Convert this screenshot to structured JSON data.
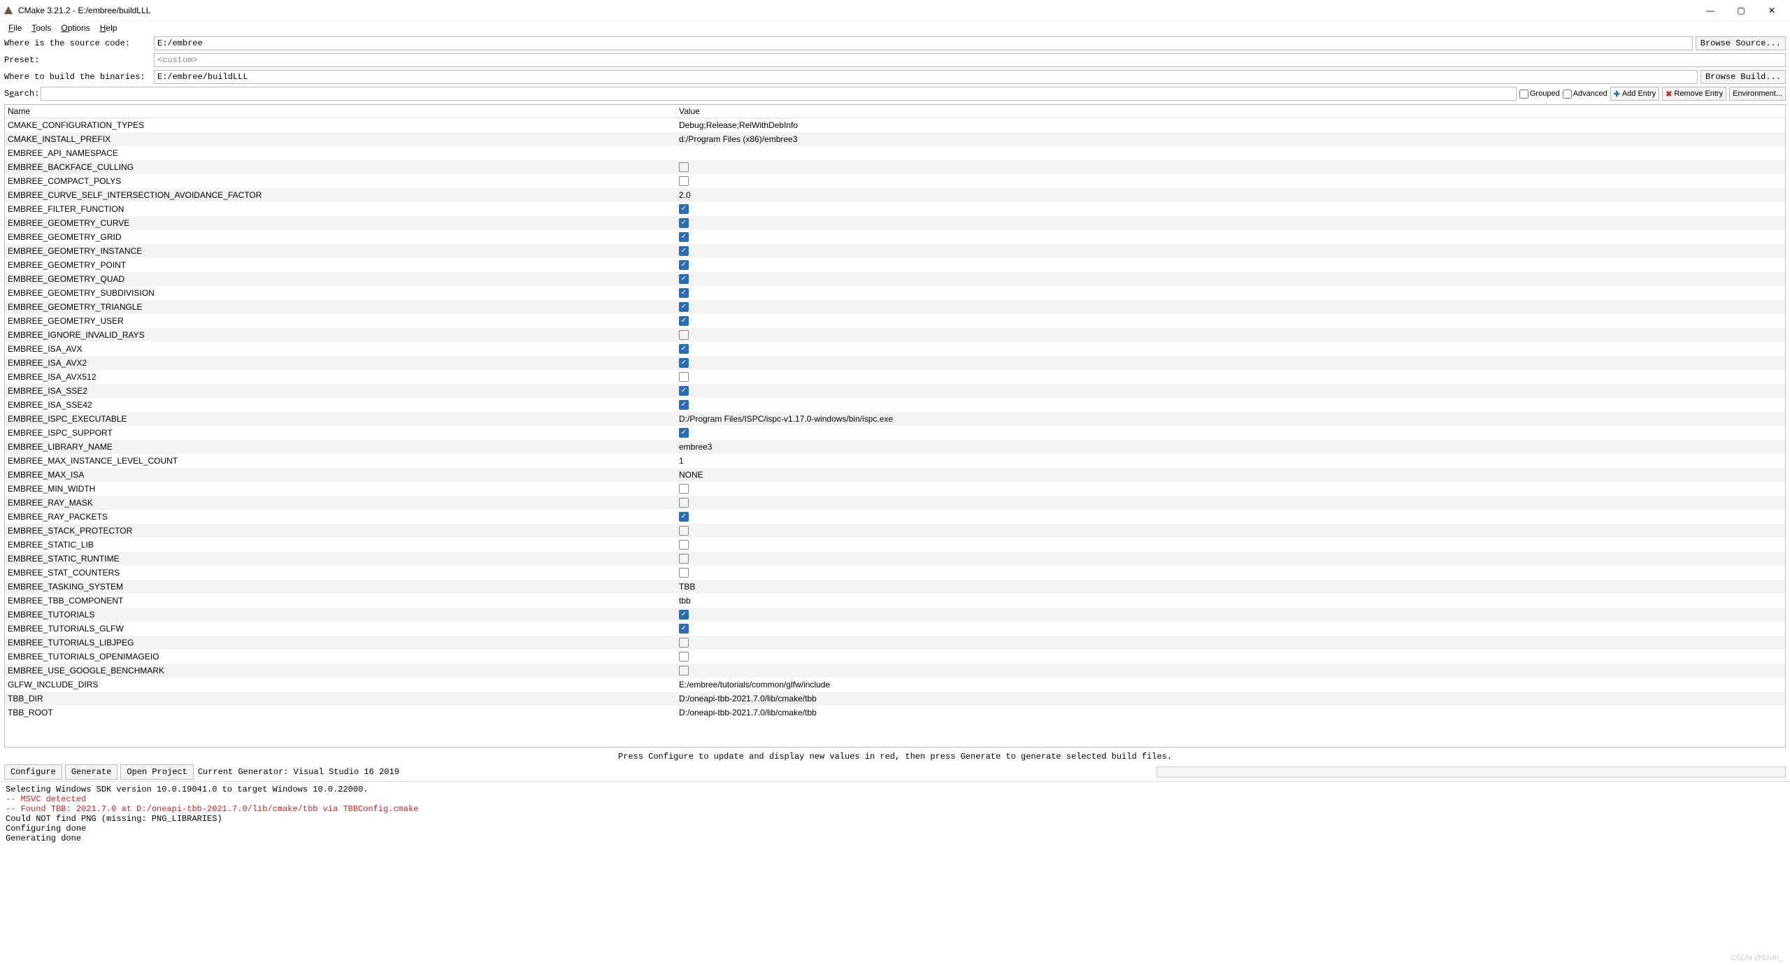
{
  "window": {
    "title": "CMake 3.21.2 - E:/embree/buildLLL",
    "minimize": "—",
    "maximize": "▢",
    "close": "✕"
  },
  "menu": {
    "file": "File",
    "tools": "Tools",
    "options": "Options",
    "help": "Help"
  },
  "paths": {
    "source_label": "Where is the source code:",
    "source_value": "E:/embree",
    "browse_source": "Browse Source...",
    "preset_label": "Preset:",
    "preset_value": "<custom>",
    "build_label": "Where to build the binaries:",
    "build_value": "E:/embree/buildLLL",
    "browse_build": "Browse Build..."
  },
  "search": {
    "label": "Search:",
    "value": "",
    "grouped": "Grouped",
    "advanced": "Advanced",
    "add_entry": "Add Entry",
    "remove_entry": "Remove Entry",
    "environment": "Environment..."
  },
  "table": {
    "header_name": "Name",
    "header_value": "Value",
    "rows": [
      {
        "name": "CMAKE_CONFIGURATION_TYPES",
        "type": "text",
        "value": "Debug;Release;RelWithDebInfo"
      },
      {
        "name": "CMAKE_INSTALL_PREFIX",
        "type": "text",
        "value": "d:/Program Files (x86)/embree3"
      },
      {
        "name": "EMBREE_API_NAMESPACE",
        "type": "text",
        "value": ""
      },
      {
        "name": "EMBREE_BACKFACE_CULLING",
        "type": "check",
        "value": false
      },
      {
        "name": "EMBREE_COMPACT_POLYS",
        "type": "check",
        "value": false
      },
      {
        "name": "EMBREE_CURVE_SELF_INTERSECTION_AVOIDANCE_FACTOR",
        "type": "text",
        "value": "2.0"
      },
      {
        "name": "EMBREE_FILTER_FUNCTION",
        "type": "check",
        "value": true
      },
      {
        "name": "EMBREE_GEOMETRY_CURVE",
        "type": "check",
        "value": true
      },
      {
        "name": "EMBREE_GEOMETRY_GRID",
        "type": "check",
        "value": true
      },
      {
        "name": "EMBREE_GEOMETRY_INSTANCE",
        "type": "check",
        "value": true
      },
      {
        "name": "EMBREE_GEOMETRY_POINT",
        "type": "check",
        "value": true
      },
      {
        "name": "EMBREE_GEOMETRY_QUAD",
        "type": "check",
        "value": true
      },
      {
        "name": "EMBREE_GEOMETRY_SUBDIVISION",
        "type": "check",
        "value": true
      },
      {
        "name": "EMBREE_GEOMETRY_TRIANGLE",
        "type": "check",
        "value": true
      },
      {
        "name": "EMBREE_GEOMETRY_USER",
        "type": "check",
        "value": true
      },
      {
        "name": "EMBREE_IGNORE_INVALID_RAYS",
        "type": "check",
        "value": false
      },
      {
        "name": "EMBREE_ISA_AVX",
        "type": "check",
        "value": true
      },
      {
        "name": "EMBREE_ISA_AVX2",
        "type": "check",
        "value": true
      },
      {
        "name": "EMBREE_ISA_AVX512",
        "type": "check",
        "value": false
      },
      {
        "name": "EMBREE_ISA_SSE2",
        "type": "check",
        "value": true
      },
      {
        "name": "EMBREE_ISA_SSE42",
        "type": "check",
        "value": true
      },
      {
        "name": "EMBREE_ISPC_EXECUTABLE",
        "type": "text",
        "value": "D:/Program Files/ISPC/ispc-v1.17.0-windows/bin/ispc.exe"
      },
      {
        "name": "EMBREE_ISPC_SUPPORT",
        "type": "check",
        "value": true
      },
      {
        "name": "EMBREE_LIBRARY_NAME",
        "type": "text",
        "value": "embree3"
      },
      {
        "name": "EMBREE_MAX_INSTANCE_LEVEL_COUNT",
        "type": "text",
        "value": "1"
      },
      {
        "name": "EMBREE_MAX_ISA",
        "type": "text",
        "value": "NONE"
      },
      {
        "name": "EMBREE_MIN_WIDTH",
        "type": "check",
        "value": false
      },
      {
        "name": "EMBREE_RAY_MASK",
        "type": "check",
        "value": false
      },
      {
        "name": "EMBREE_RAY_PACKETS",
        "type": "check",
        "value": true
      },
      {
        "name": "EMBREE_STACK_PROTECTOR",
        "type": "check",
        "value": false
      },
      {
        "name": "EMBREE_STATIC_LIB",
        "type": "check",
        "value": false
      },
      {
        "name": "EMBREE_STATIC_RUNTIME",
        "type": "check",
        "value": false
      },
      {
        "name": "EMBREE_STAT_COUNTERS",
        "type": "check",
        "value": false
      },
      {
        "name": "EMBREE_TASKING_SYSTEM",
        "type": "text",
        "value": "TBB"
      },
      {
        "name": "EMBREE_TBB_COMPONENT",
        "type": "text",
        "value": "tbb"
      },
      {
        "name": "EMBREE_TUTORIALS",
        "type": "check",
        "value": true
      },
      {
        "name": "EMBREE_TUTORIALS_GLFW",
        "type": "check",
        "value": true
      },
      {
        "name": "EMBREE_TUTORIALS_LIBJPEG",
        "type": "check",
        "value": false
      },
      {
        "name": "EMBREE_TUTORIALS_OPENIMAGEIO",
        "type": "check",
        "value": false
      },
      {
        "name": "EMBREE_USE_GOOGLE_BENCHMARK",
        "type": "check",
        "value": false
      },
      {
        "name": "GLFW_INCLUDE_DIRS",
        "type": "text",
        "value": "E:/embree/tutorials/common/glfw/include"
      },
      {
        "name": "TBB_DIR",
        "type": "text",
        "value": "D:/oneapi-tbb-2021.7.0/lib/cmake/tbb"
      },
      {
        "name": "TBB_ROOT",
        "type": "text",
        "value": "D:/oneapi-tbb-2021.7.0/lib/cmake/tbb"
      }
    ]
  },
  "hint": "Press Configure to update and display new values in red, then press Generate to generate selected build files.",
  "actions": {
    "configure": "Configure",
    "generate": "Generate",
    "open_project": "Open Project",
    "generator_label": "Current Generator: Visual Studio 16 2019"
  },
  "log": {
    "lines": [
      {
        "text": "Selecting Windows SDK version 10.0.19041.0 to target Windows 10.0.22000.",
        "cls": ""
      },
      {
        "text": "-- MSVC detected",
        "cls": "red"
      },
      {
        "text": "-- Found TBB: 2021.7.0 at D:/oneapi-tbb-2021.7.0/lib/cmake/tbb via TBBConfig.cmake",
        "cls": "red"
      },
      {
        "text": "Could NOT find PNG (missing: PNG_LIBRARIES)",
        "cls": ""
      },
      {
        "text": "Configuring done",
        "cls": ""
      },
      {
        "text": "Generating done",
        "cls": ""
      }
    ]
  },
  "watermark": "CSDN @Elvin_"
}
